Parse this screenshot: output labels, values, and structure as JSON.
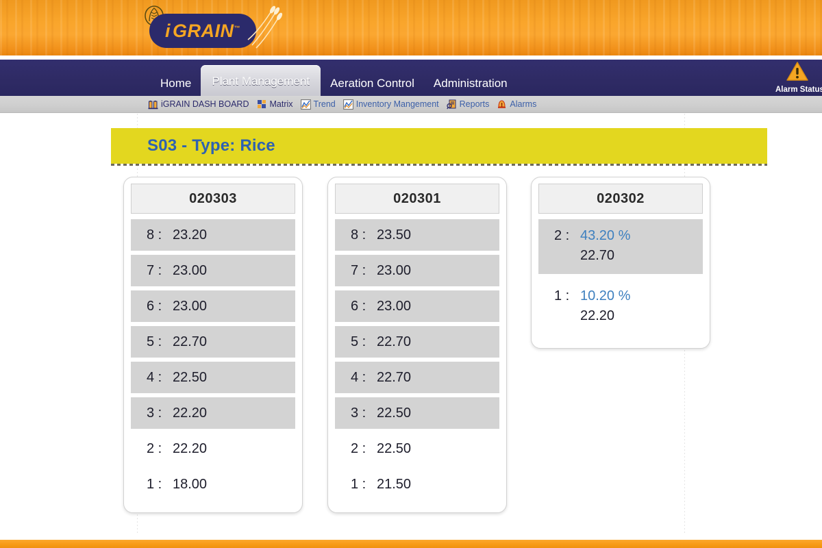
{
  "brand": {
    "logo_text": "GRAIN",
    "logo_prefix": "i",
    "trademark": "™",
    "wheat_icon": "wheat-sheaf-icon"
  },
  "mainnav": {
    "items": [
      {
        "label": "Home",
        "active": false
      },
      {
        "label": "Plant Management",
        "active": true
      },
      {
        "label": "Aeration Control",
        "active": false
      },
      {
        "label": "Administration",
        "active": false
      }
    ],
    "alarm_status_label": "Alarm Status",
    "alarm_icon": "warning-triangle-icon"
  },
  "subnav": {
    "items": [
      {
        "label": "iGRAIN DASH BOARD",
        "icon": "silo-icon",
        "link": false
      },
      {
        "label": "Matrix",
        "icon": "grid-squares-icon",
        "link": false
      },
      {
        "label": "Trend",
        "icon": "line-chart-icon",
        "link": true
      },
      {
        "label": "Inventory Mangement",
        "icon": "line-chart-icon",
        "link": true
      },
      {
        "label": "Reports",
        "icon": "report-search-icon",
        "link": true
      },
      {
        "label": "Alarms",
        "icon": "bell-alert-icon",
        "link": true
      }
    ]
  },
  "page": {
    "title": "S03 - Type: Rice"
  },
  "colors": {
    "banner_orange": "#f9a52b",
    "nav_navy": "#2f2b65",
    "title_yellow": "#e3d71f",
    "title_blue": "#2f62b0",
    "percent_blue": "#3e80bf",
    "row_shade": "#d3d3d3"
  },
  "cards": [
    {
      "id": "020303",
      "type": "temperature",
      "rows": [
        {
          "level": "8 :",
          "value": "23.20",
          "shaded": true
        },
        {
          "level": "7 :",
          "value": "23.00",
          "shaded": true
        },
        {
          "level": "6 :",
          "value": "23.00",
          "shaded": true
        },
        {
          "level": "5 :",
          "value": "22.70",
          "shaded": true
        },
        {
          "level": "4 :",
          "value": "22.50",
          "shaded": true
        },
        {
          "level": "3 :",
          "value": "22.20",
          "shaded": true
        },
        {
          "level": "2 :",
          "value": "22.20",
          "shaded": false
        },
        {
          "level": "1 :",
          "value": "18.00",
          "shaded": false
        }
      ]
    },
    {
      "id": "020301",
      "type": "temperature",
      "rows": [
        {
          "level": "8 :",
          "value": "23.50",
          "shaded": true
        },
        {
          "level": "7 :",
          "value": "23.00",
          "shaded": true
        },
        {
          "level": "6 :",
          "value": "23.00",
          "shaded": true
        },
        {
          "level": "5 :",
          "value": "22.70",
          "shaded": true
        },
        {
          "level": "4 :",
          "value": "22.70",
          "shaded": true
        },
        {
          "level": "3 :",
          "value": "22.50",
          "shaded": true
        },
        {
          "level": "2 :",
          "value": "22.50",
          "shaded": false
        },
        {
          "level": "1 :",
          "value": "21.50",
          "shaded": false
        }
      ]
    },
    {
      "id": "020302",
      "type": "percent",
      "rows": [
        {
          "level": "2 :",
          "percent": "43.20 %",
          "value": "22.70",
          "shaded": true
        },
        {
          "level": "1 :",
          "percent": "10.20 %",
          "value": "22.20",
          "shaded": false
        }
      ]
    }
  ]
}
